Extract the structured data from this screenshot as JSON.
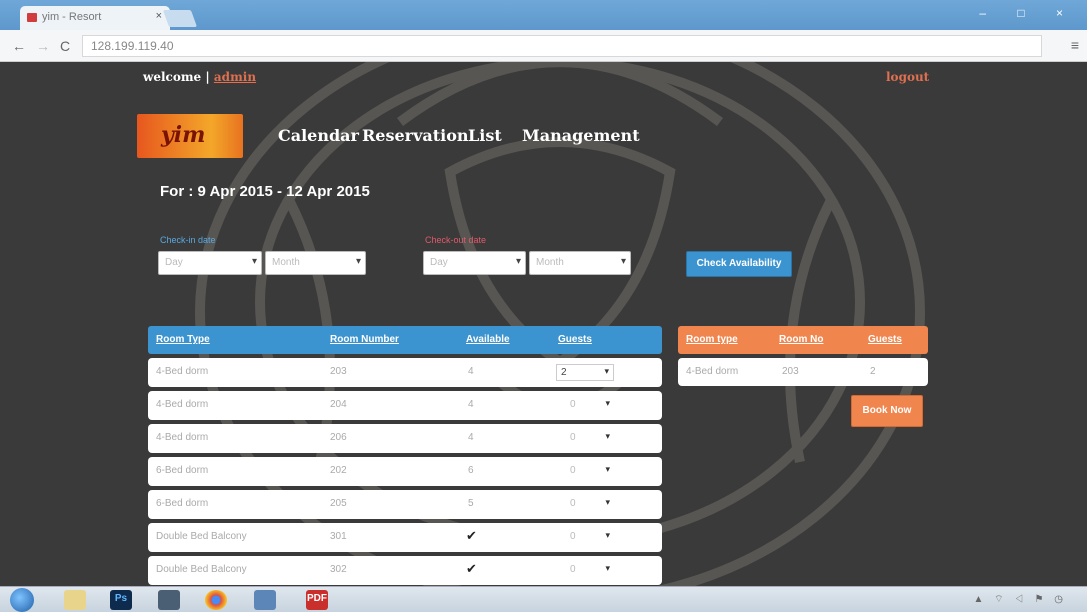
{
  "browser": {
    "tab_title": "yim - Resort",
    "tab_close": "×",
    "window_controls": "– □ ×",
    "back_glyph": "←",
    "forward_glyph": "→",
    "reload_glyph": "C",
    "url": "128.199.119.40",
    "menu_glyph": "≡"
  },
  "header": {
    "welcome_prefix": "welcome |",
    "username": "admin",
    "logout": "logout"
  },
  "logo_text": "yim",
  "nav": {
    "calendar": "Calendar",
    "reservation": "Reservation",
    "list": "List",
    "management": "Management"
  },
  "date_range": "For : 9 Apr 2015 - 12 Apr 2015",
  "filters": {
    "checkin_label": "Check-in date",
    "checkout_label": "Check-out date",
    "day_placeholder": "Day",
    "month_placeholder": "Month",
    "caret": "▾",
    "check_button": "Check Availability"
  },
  "rooms": {
    "headers": [
      "Room Type",
      "Room Number",
      "Available",
      "Guests"
    ],
    "rows": [
      {
        "type": "4-Bed dorm",
        "number": "203",
        "available": "4",
        "guests": "2"
      },
      {
        "type": "4-Bed dorm",
        "number": "204",
        "available": "4",
        "guests": "0"
      },
      {
        "type": "4-Bed dorm",
        "number": "206",
        "available": "4",
        "guests": "0"
      },
      {
        "type": "6-Bed dorm",
        "number": "202",
        "available": "6",
        "guests": "0"
      },
      {
        "type": "6-Bed dorm",
        "number": "205",
        "available": "5",
        "guests": "0"
      },
      {
        "type": "Double Bed Balcony",
        "number": "301",
        "available": "✔",
        "guests": "0"
      },
      {
        "type": "Double Bed Balcony",
        "number": "302",
        "available": "✔",
        "guests": "0"
      }
    ]
  },
  "booking": {
    "headers": [
      "Room type",
      "Room No",
      "Guests"
    ],
    "rows": [
      {
        "type": "4-Bed dorm",
        "number": "203",
        "guests": "2"
      }
    ],
    "book_button": "Book Now"
  },
  "taskbar": {
    "items": [
      "Ps",
      "",
      "",
      "",
      "PDF"
    ],
    "tray": "▲ ⌔ ◁ ⚑ ◷"
  },
  "colors": {
    "accent_blue": "#3b94cf",
    "accent_orange": "#f0854d",
    "page_bg": "#3a3a3a",
    "link_red": "#e07050"
  }
}
